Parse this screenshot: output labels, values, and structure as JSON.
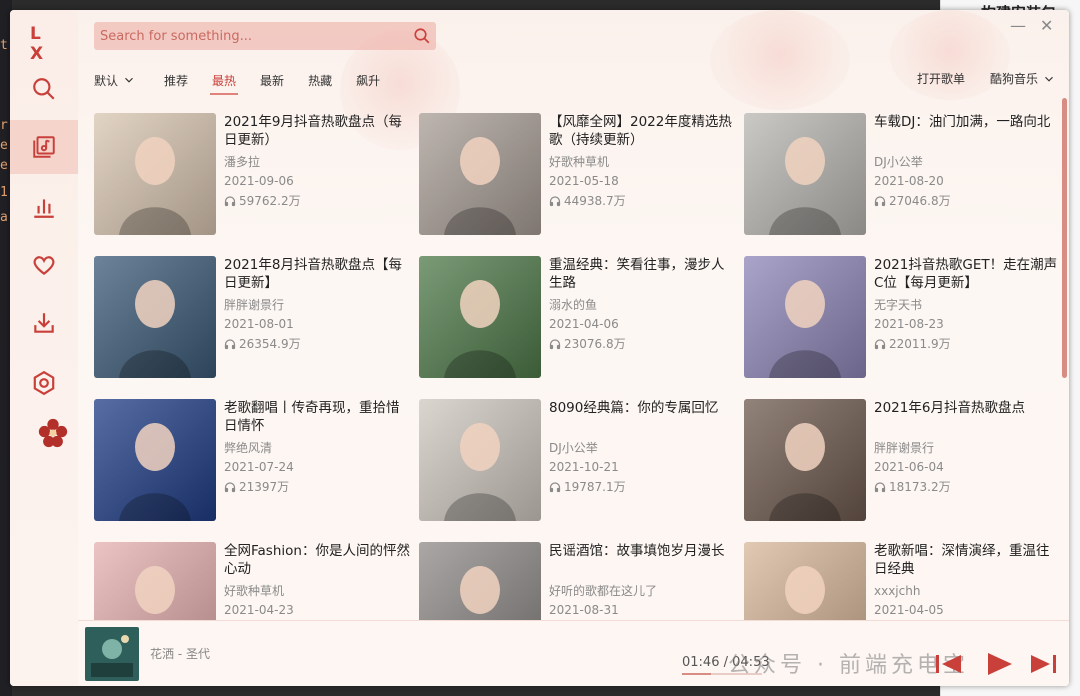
{
  "app": {
    "logo": "L X",
    "search_placeholder": "Search for something...",
    "window_controls": {
      "minimize": "—",
      "close": "✕"
    }
  },
  "sidebar": {
    "items": [
      {
        "name": "search",
        "icon": "search-icon"
      },
      {
        "name": "song-list",
        "icon": "music-list-icon",
        "active": true
      },
      {
        "name": "leaderboard",
        "icon": "chart-icon"
      },
      {
        "name": "favorites",
        "icon": "heart-icon"
      },
      {
        "name": "download",
        "icon": "download-icon"
      },
      {
        "name": "settings",
        "icon": "settings-icon"
      }
    ]
  },
  "tabs": {
    "sort": "默认",
    "items": [
      "推荐",
      "最热",
      "最新",
      "热藏",
      "飙升"
    ],
    "active": "最热",
    "open_list": "打开歌单",
    "source": "酷狗音乐"
  },
  "playlists": [
    {
      "title": "2021年9月抖音热歌盘点（每日更新）",
      "author": "潘多拉",
      "date": "2021-09-06",
      "plays": "59762.2万",
      "color": "#d9c6b1"
    },
    {
      "title": "【风靡全网】2022年度精选热歌（持续更新）",
      "author": "好歌种草机",
      "date": "2021-05-18",
      "plays": "44938.7万",
      "color": "#a89d95"
    },
    {
      "title": "车载DJ：油门加满，一路向北",
      "author": "DJ小公举",
      "date": "2021-08-20",
      "plays": "27046.8万",
      "color": "#b9b7b2"
    },
    {
      "title": "2021年8月抖音热歌盘点【每日更新】",
      "author": "胖胖谢景行",
      "date": "2021-08-01",
      "plays": "26354.9万",
      "color": "#3b5a77"
    },
    {
      "title": "重温经典：笑看往事，漫步人生路",
      "author": "溺水的鱼",
      "date": "2021-04-06",
      "plays": "23076.8万",
      "color": "#4f7a4a"
    },
    {
      "title": "2021抖音热歌GET！走在潮声C位【每月更新】",
      "author": "无字天书",
      "date": "2021-08-23",
      "plays": "22011.9万",
      "color": "#8f86b8"
    },
    {
      "title": "老歌翻唱丨传奇再现，重拾惜日情怀",
      "author": "弊绝风清",
      "date": "2021-07-24",
      "plays": "21397万",
      "color": "#1f3d86"
    },
    {
      "title": "8090经典篇：你的专属回忆",
      "author": "DJ小公举",
      "date": "2021-10-21",
      "plays": "19787.1万",
      "color": "#cfc8c0"
    },
    {
      "title": "2021年6月抖音热歌盘点",
      "author": "胖胖谢景行",
      "date": "2021-06-04",
      "plays": "18173.2万",
      "color": "#6e5a4e"
    },
    {
      "title": "全网Fashion：你是人间的怦然心动",
      "author": "好歌种草机",
      "date": "2021-04-23",
      "plays": "",
      "color": "#e6b0b0"
    },
    {
      "title": "民谣酒馆：故事填饱岁月漫长",
      "author": "好听的歌都在这儿了",
      "date": "2021-08-31",
      "plays": "",
      "color": "#8e8a88"
    },
    {
      "title": "老歌新唱：深情演绎，重温往日经典",
      "author": "xxxjchh",
      "date": "2021-04-05",
      "plays": "",
      "color": "#d8b79a"
    }
  ],
  "player": {
    "title": "花洒 - 圣代",
    "current_time": "01:46",
    "separator": "/",
    "duration": "04:53",
    "progress": 0.36,
    "watermark": "公众号 · 前端充电宝"
  },
  "background": {
    "right_title": "构建安装包"
  }
}
